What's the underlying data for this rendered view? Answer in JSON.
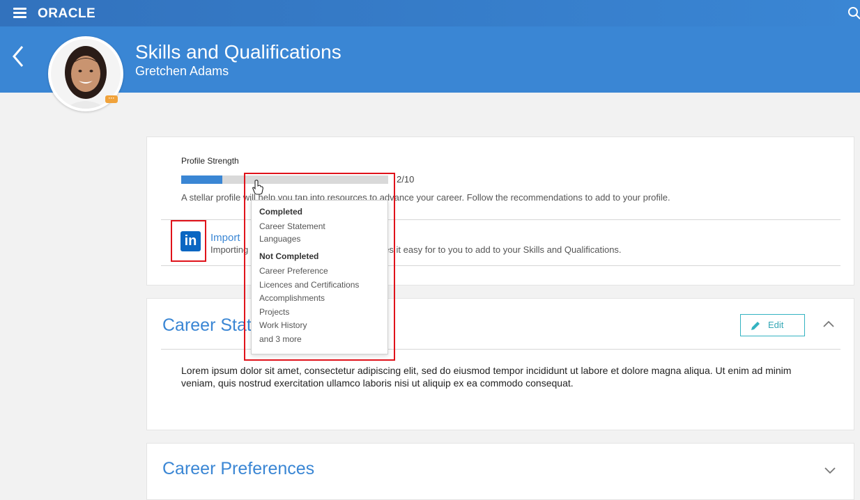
{
  "app": {
    "logo": "ORACLE"
  },
  "header": {
    "title": "Skills and Qualifications",
    "subtitle": "Gretchen Adams",
    "badge": "···"
  },
  "profile_strength": {
    "label": "Profile Strength",
    "progress_fraction": 0.2,
    "count": "2/10",
    "description": "A stellar profile will help you tap into resources to advance your career. Follow the recommendations to add to your profile."
  },
  "import": {
    "link": "Import",
    "text_start": "Importing",
    "text_end": "es it easy for to you to add to your Skills and Qualifications.",
    "icon_glyph": "in"
  },
  "career_statement": {
    "title": "Career Stat",
    "edit_label": "Edit",
    "body": "Lorem ipsum dolor sit amet, consectetur adipiscing elit, sed do eiusmod tempor incididunt ut labore et dolore magna aliqua. Ut enim ad minim veniam, quis nostrud exercitation ullamco laboris nisi ut aliquip ex ea commodo consequat."
  },
  "career_preferences": {
    "title": "Career Preferences"
  },
  "popup": {
    "completed_heading": "Completed",
    "completed": [
      "Career Statement",
      "Languages"
    ],
    "not_completed_heading": "Not Completed",
    "not_completed": [
      "Career Preference",
      "Licences and Certifications",
      "Accomplishments",
      "Projects",
      "Work History",
      "and 3 more"
    ]
  },
  "colors": {
    "brand_blue": "#3a86d4",
    "linkedin": "#0a66c2",
    "highlight_red": "#e0121a",
    "edit_teal": "#33b3c1"
  }
}
